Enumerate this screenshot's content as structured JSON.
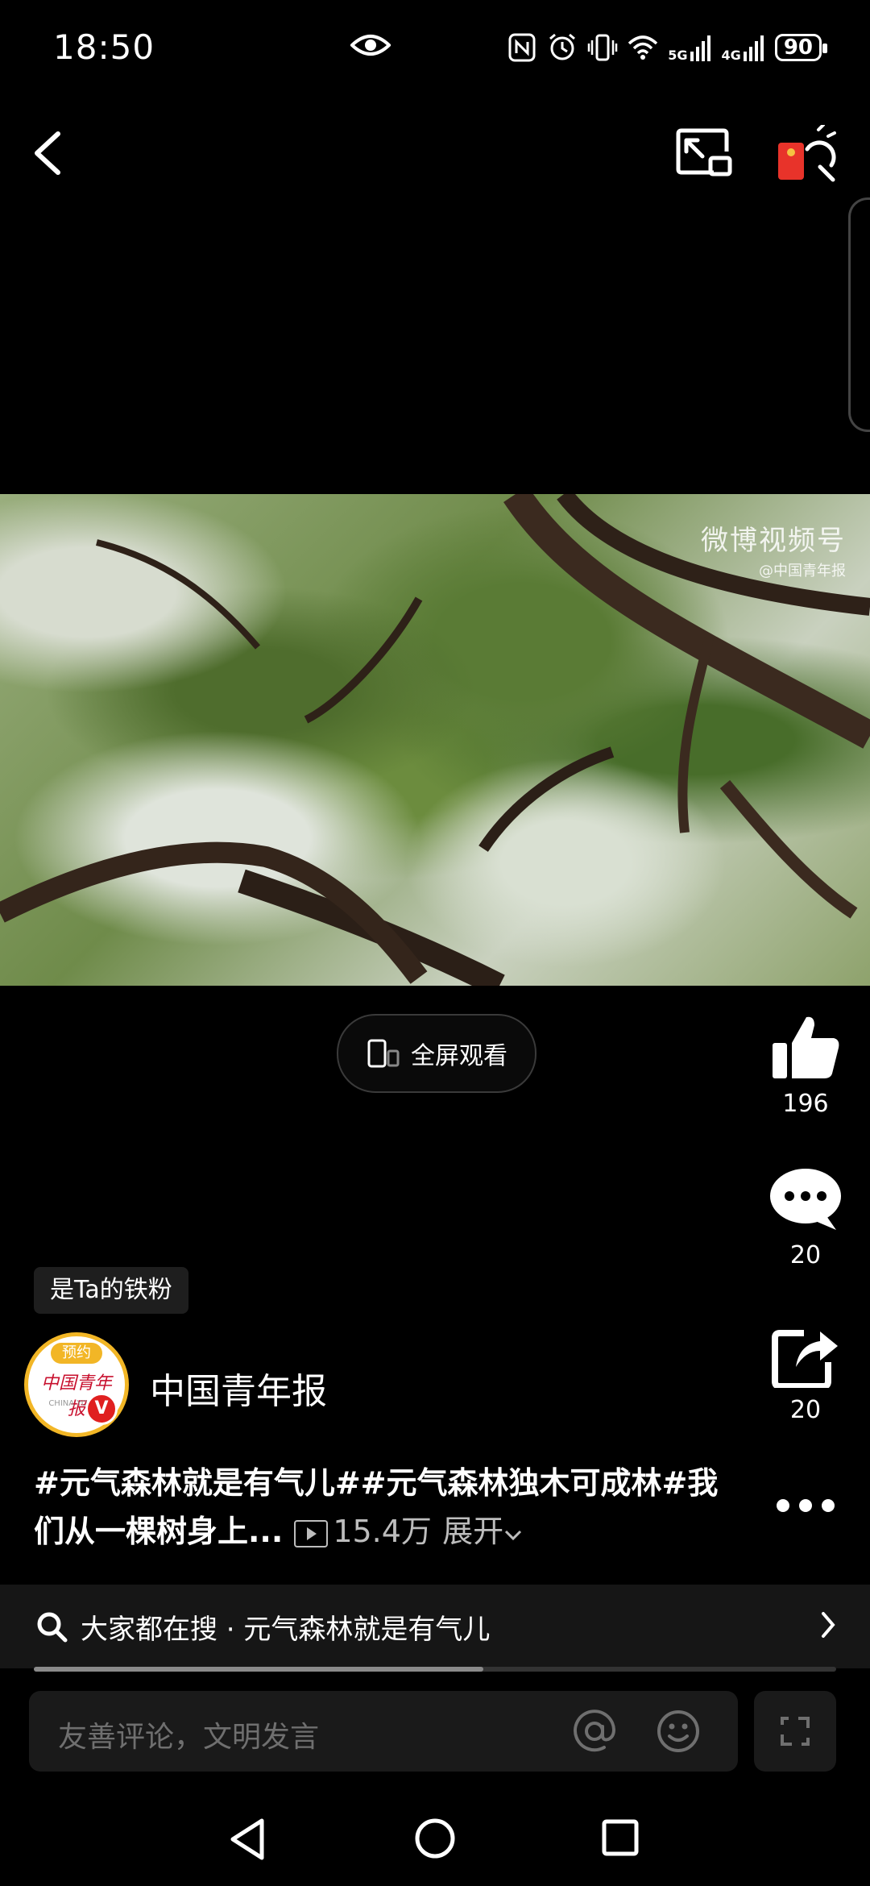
{
  "status_bar": {
    "time": "18:50",
    "network_5g": "5G",
    "network_4g": "4G",
    "battery": "90"
  },
  "video": {
    "watermark_title": "微博视频号",
    "watermark_account": "@中国青年报"
  },
  "fullscreen_label": "全屏观看",
  "actions": {
    "like_count": "196",
    "comment_count": "20",
    "share_count": "20"
  },
  "fan_badge": "是Ta的铁粉",
  "account": {
    "name": "中国青年报",
    "avatar_ribbon": "预约",
    "avatar_logo": "中国青年报",
    "avatar_sub": "CHINA YOUTH",
    "verified_mark": "V"
  },
  "caption": {
    "text": "#元气森林就是有气儿##元气森林独木可成林#我们从一棵树身上...",
    "views": "15.4万",
    "expand": "展开"
  },
  "search": {
    "text": "大家都在搜 · 元气森林就是有气儿"
  },
  "progress": {
    "value": 0.56
  },
  "comment": {
    "placeholder": "友善评论，文明发言"
  },
  "colors": {
    "background": "#000000",
    "avatar_ring": "#f2b626",
    "verified": "#e02020",
    "red_packet": "#e8332a"
  }
}
